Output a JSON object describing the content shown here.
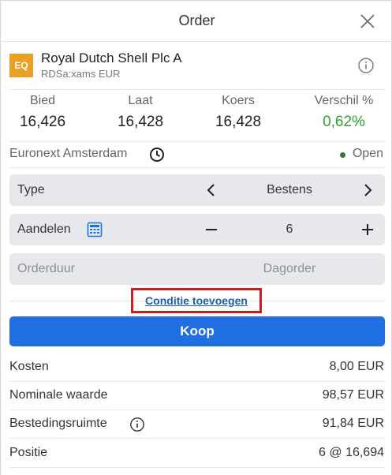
{
  "header": {
    "title": "Order",
    "close_icon": "close-icon"
  },
  "instrument": {
    "badge": "EQ",
    "badge_color": "#e9a024",
    "name": "Royal Dutch Shell Plc A",
    "subtitle": "RDSa:xams EUR",
    "info_icon": "info-icon"
  },
  "quotes": [
    {
      "label": "Bied",
      "value": "16,426"
    },
    {
      "label": "Laat",
      "value": "16,428"
    },
    {
      "label": "Koers",
      "value": "16,428"
    },
    {
      "label": "Verschil %",
      "value": "0,62%",
      "color": "#2ea12e"
    }
  ],
  "market": {
    "name": "Euronext Amsterdam",
    "status": "Open",
    "status_color": "#2b7a2b",
    "clock_icon": "clock-icon"
  },
  "form": {
    "type": {
      "label": "Type",
      "value": "Bestens"
    },
    "shares": {
      "label": "Aandelen",
      "value": "6",
      "calculator_icon": "calculator-icon"
    },
    "duration": {
      "label": "Orderduur",
      "value": "Dagorder"
    }
  },
  "condition_link": "Conditie toevoegen",
  "buy_button": "Koop",
  "accent_color": "#1f6fe0",
  "summary": [
    {
      "label": "Kosten",
      "value": "8,00 EUR"
    },
    {
      "label": "Nominale waarde",
      "value": "98,57 EUR"
    },
    {
      "label": "Bestedingsruimte",
      "value": "91,84 EUR"
    },
    {
      "label": "Positie",
      "value": "6 @ 16,694"
    }
  ]
}
